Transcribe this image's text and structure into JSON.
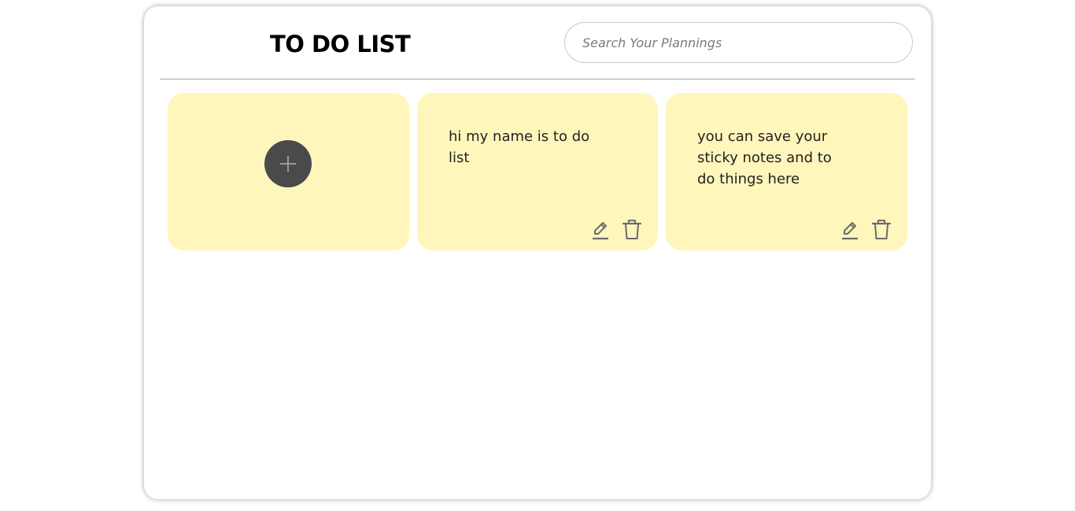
{
  "header": {
    "title": "TO DO LIST",
    "search": {
      "placeholder": "Search Your Plannings",
      "value": ""
    }
  },
  "notes": [
    {
      "text": "hi my name is to do\nlist",
      "edit_icon": "pencil-icon",
      "delete_icon": "trash-icon"
    },
    {
      "text": "you can save your\nsticky notes and to\ndo things here",
      "edit_icon": "pencil-icon",
      "delete_icon": "trash-icon"
    }
  ],
  "add_note": {
    "icon": "plus-icon"
  },
  "colors": {
    "note_background": "#fff6bb",
    "add_button": "#4a4a4a",
    "icon_color": "#6b6b6b"
  }
}
